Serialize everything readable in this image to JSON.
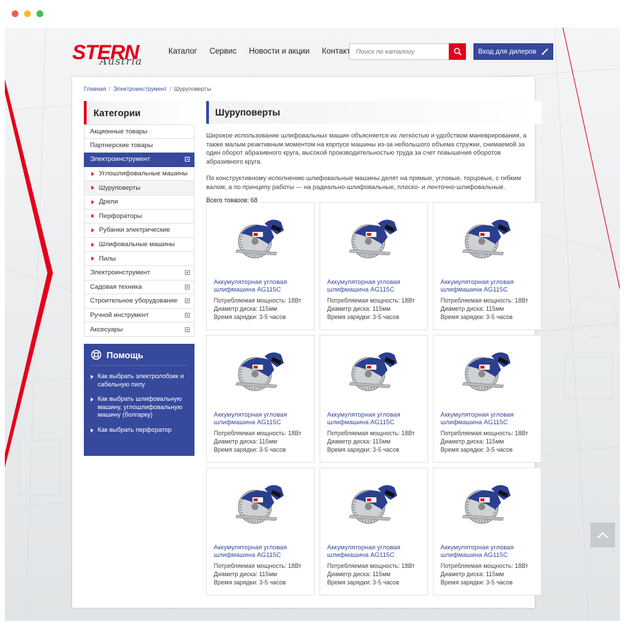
{
  "browser": {
    "dot_colors": [
      "#ee5c5c",
      "#f5bc2f",
      "#3fc24a"
    ]
  },
  "logo": {
    "brand": "STERN",
    "sub": "Austria"
  },
  "nav": {
    "items": [
      "Каталог",
      "Сервис",
      "Новости и акции",
      "Контакты"
    ]
  },
  "search": {
    "placeholder": "Поиск по каталогу"
  },
  "dealer_button": {
    "label": "Вход для дилеров"
  },
  "breadcrumb": {
    "home": "Главная",
    "section": "Электроинструмент",
    "current": "Шуруповерты"
  },
  "sidebar": {
    "title": "Категории",
    "items": [
      {
        "label": "Акционные товары"
      },
      {
        "label": "Партнерские товары"
      },
      {
        "label": "Электроинструмент"
      },
      {
        "label": "Углошлифовальные машины"
      },
      {
        "label": "Шуруповерты"
      },
      {
        "label": "Дрели"
      },
      {
        "label": "Перфораторы"
      },
      {
        "label": "Рубанки электрические"
      },
      {
        "label": "Шлифовальные машины"
      },
      {
        "label": "Пилы"
      },
      {
        "label": "Электроинструмент"
      },
      {
        "label": "Садовая техника"
      },
      {
        "label": "Строительное уборудование"
      },
      {
        "label": "Ручной инструмент"
      },
      {
        "label": "Аксесуары"
      }
    ]
  },
  "help": {
    "title": "Помощь",
    "links": [
      "Как выбрать электролобзик и сабельную пилу",
      "Как выбрать шлифовальную машину, углошлифовальную машину (болгарку)",
      "Как выбрать перфоратор"
    ]
  },
  "main": {
    "title": "Шуруповерты",
    "desc1": "Широкое использование шлифовальных машин объясняется их легкостью и удобством маневрирования, а также малым реактивным моментом на корпусе машины из-за небольшого объема стружки, снимаемой за один оборот абразивного круга, высокой производительностью труда за счет повышения оборотов абразивного круга.",
    "desc2": "По конструктивному исполнению шлифовальные машины делят на прямые, угловые, торцовые, с гибким валом, а по принципу работы — на радиально-шлифовальные, плоско- и ленточно-шлифовальные.",
    "total": "Всего товаров: 68"
  },
  "products": [
    {
      "title": "Аккумуляторная угловая шлифмашина AG115C",
      "power": "Потребляемая мощность: 18Вт",
      "disk": "Диаметр диска: 115мм",
      "charge": "Время зарядки: 3-5 часов"
    },
    {
      "title": "Аккумуляторная угловая шлифмашина AG115C",
      "power": "Потребляемая мощность: 18Вт",
      "disk": "Диаметр диска: 115мм",
      "charge": "Время зарядки: 3-5 часов"
    },
    {
      "title": "Аккумуляторная угловая шлифмашина AG115C",
      "power": "Потребляемая мощность: 18Вт",
      "disk": "Диаметр диска: 115мм",
      "charge": "Время зарядки: 3-5 часов"
    },
    {
      "title": "Аккумуляторная угловая шлифмашина AG115C",
      "power": "Потребляемая мощность: 18Вт",
      "disk": "Диаметр диска: 115мм",
      "charge": "Время зарядки: 3-5 часов"
    },
    {
      "title": "Аккумуляторная угловая шлифмашина AG115C",
      "power": "Потребляемая мощность: 18Вт",
      "disk": "Диаметр диска: 115мм",
      "charge": "Время зарядки: 3-5 часов"
    },
    {
      "title": "Аккумуляторная угловая шлифмашина AG115C",
      "power": "Потребляемая мощность: 18Вт",
      "disk": "Диаметр диска: 115мм",
      "charge": "Время зарядки: 3-5 часов"
    },
    {
      "title": "Аккумуляторная угловая шлифмашина AG115C",
      "power": "Потребляемая мощность: 18Вт",
      "disk": "Диаметр диска: 115мм",
      "charge": "Время зарядки: 3-5 часов"
    },
    {
      "title": "Аккумуляторная угловая шлифмашина AG115C",
      "power": "Потребляемая мощность: 18Вт",
      "disk": "Диаметр диска: 115мм",
      "charge": "Время зарядки: 3-5 часов"
    },
    {
      "title": "Аккумуляторная угловая шлифмашина AG115C",
      "power": "Потребляемая мощность: 18Вт",
      "disk": "Диаметр диска: 115мм",
      "charge": "Время зарядки: 3-5 часов"
    }
  ],
  "colors": {
    "brand_red": "#e3001b",
    "brand_blue": "#36499d"
  }
}
